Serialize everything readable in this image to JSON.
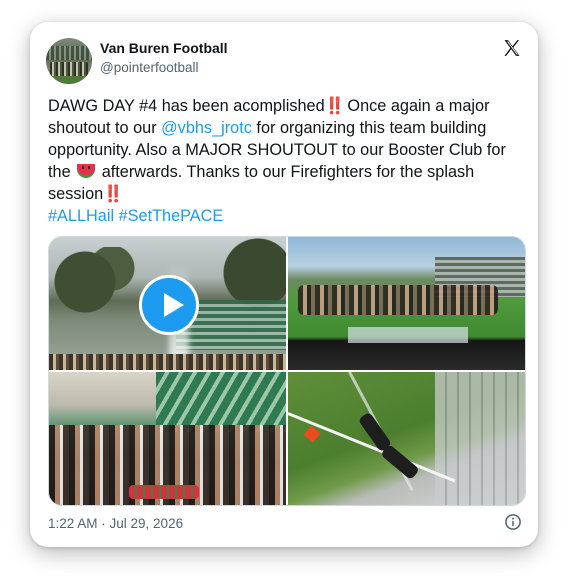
{
  "author": {
    "name": "Van Buren Football",
    "handle": "@pointerfootball"
  },
  "tweet": {
    "line_1_a": "DAWG DAY #4 has been acomplished",
    "line_1_b": " Once again a major shoutout to our ",
    "mention": "@vbhs_jrotc",
    "line_2": " for organizing this team building opportunity. Also a MAJOR SHOUTOUT to our Booster Club for the ",
    "line_3": " afterwards. Thanks to our Firefighters for the splash session",
    "hashtag_1": "#ALLHail",
    "hashtag_2": "#SetThePACE",
    "bang_emoji": "‼️",
    "watermelon_emoji": "watermelon-emoji"
  },
  "media": {
    "items": [
      {
        "kind": "video",
        "description_icon": "play-icon"
      },
      {
        "kind": "photo"
      },
      {
        "kind": "photo"
      },
      {
        "kind": "photo"
      }
    ]
  },
  "footer": {
    "timestamp": "1:22 AM · Jul 29, 2026"
  },
  "colors": {
    "link": "#1d9bf0",
    "text": "#0f1419",
    "secondary": "#536471",
    "play_button": "#1d9bf0"
  },
  "icons": {
    "platform": "x-logo-icon",
    "info": "info-icon"
  }
}
